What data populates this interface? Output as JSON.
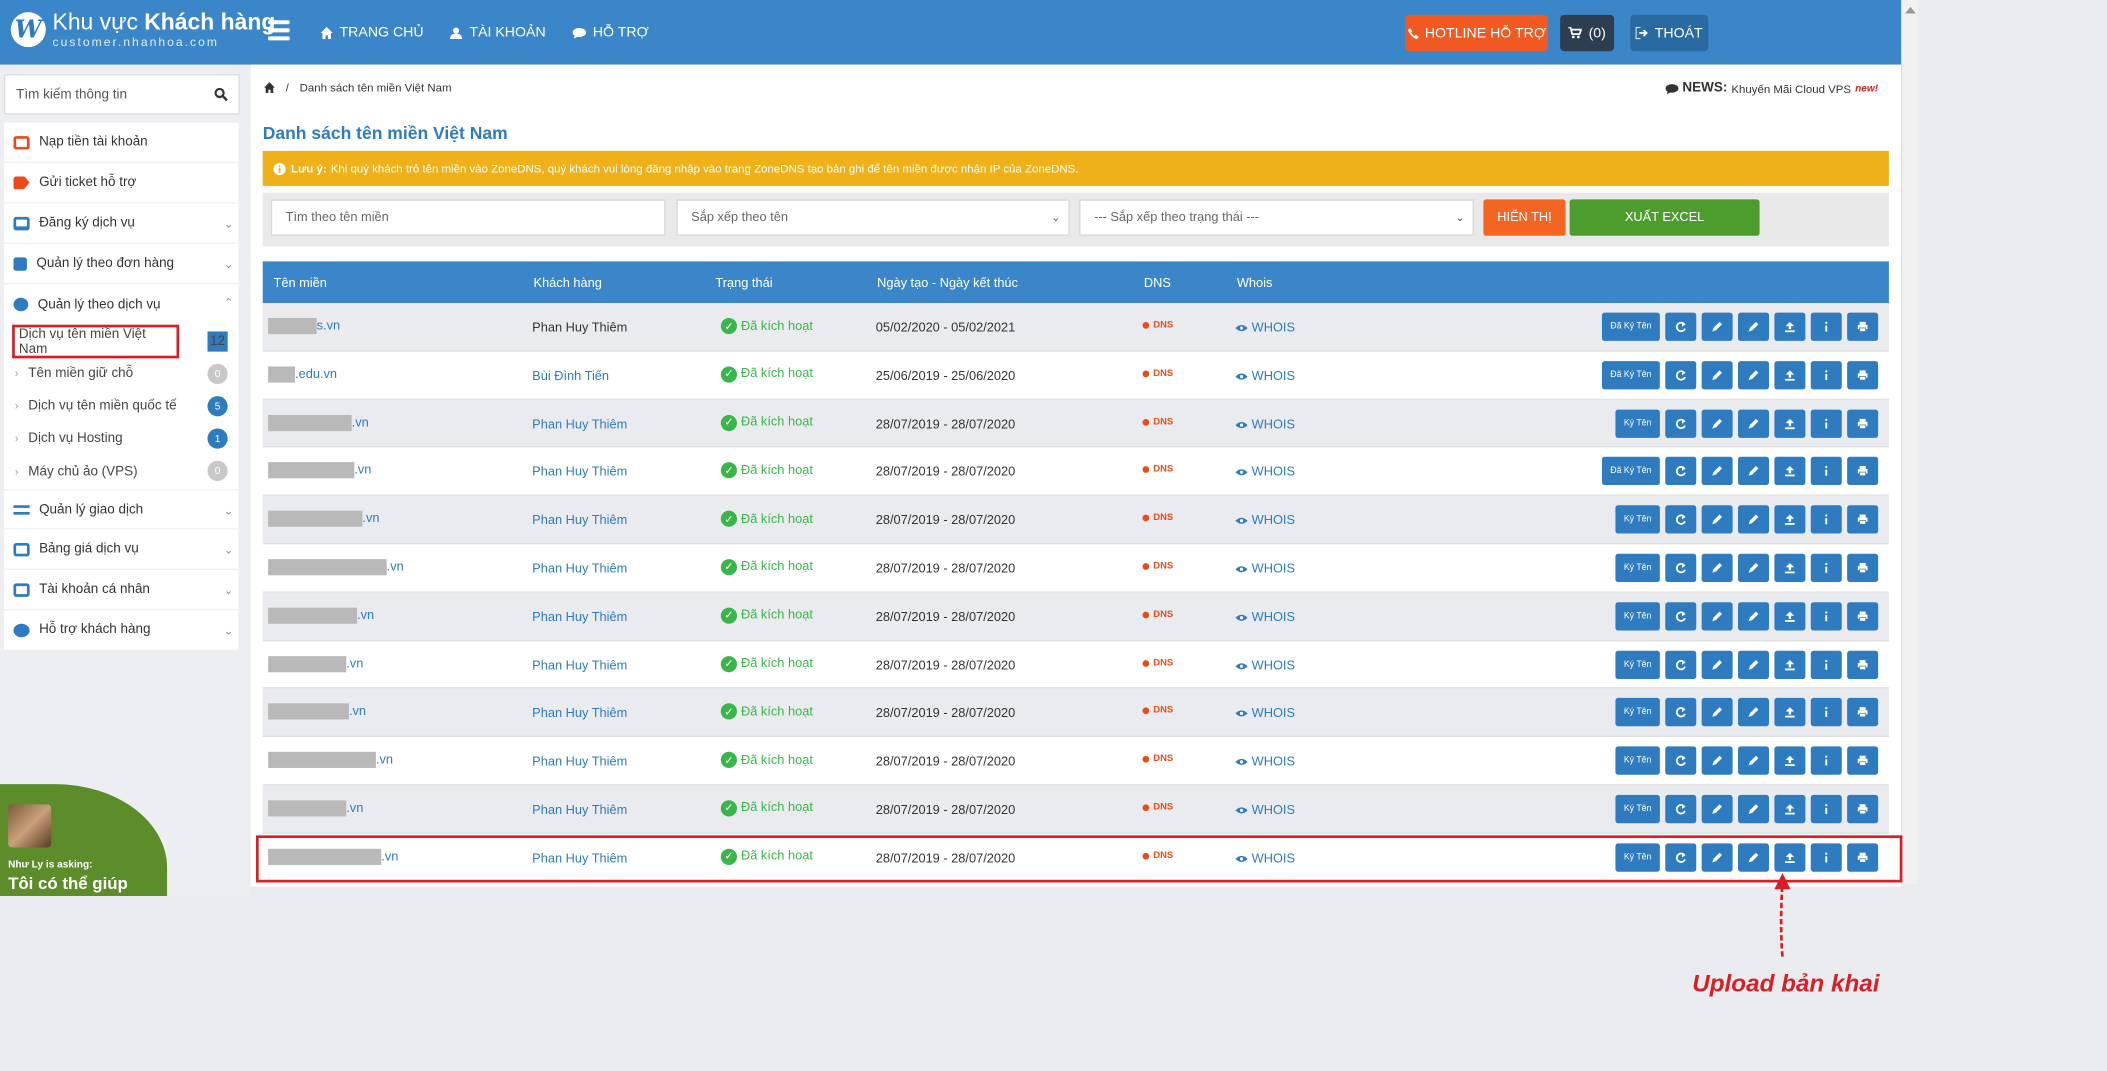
{
  "app": {
    "logo_title_regular": "Khu vực ",
    "logo_title_bold": "Khách hàng",
    "logo_subtitle": "customer.nhanhoa.com",
    "logo_letter": "W"
  },
  "nav": [
    {
      "label": "TRANG CHỦ",
      "icon": "home-icon"
    },
    {
      "label": "TÀI KHOẢN",
      "icon": "user-icon"
    },
    {
      "label": "HỖ TRỢ",
      "icon": "chat-icon"
    }
  ],
  "header_buttons": {
    "hotline": "HOTLINE HỖ TRỢ",
    "cart": "(0)",
    "logout": "THOÁT"
  },
  "sidebar": {
    "search_placeholder": "Tìm kiếm thông tin",
    "items": [
      {
        "label": "Nạp tiền tài khoản",
        "icon": "wallet-icon",
        "color": "#e94b1a",
        "chevron": false
      },
      {
        "label": "Gửi ticket hỗ trợ",
        "icon": "tag-icon",
        "color": "#e94b1a",
        "chevron": false
      },
      {
        "label": "Đăng ký dịch vụ",
        "icon": "laptop-icon",
        "color": "#2e7bbf",
        "chevron": true
      },
      {
        "label": "Quản lý theo đơn hàng",
        "icon": "document-icon",
        "color": "#2e7bbf",
        "chevron": true
      },
      {
        "label": "Quản lý theo dịch vụ",
        "icon": "cogs-icon",
        "color": "#2e7bbf",
        "chevron": true
      }
    ],
    "subitems": [
      {
        "label": "Dịch vụ tên miền Việt Nam",
        "count": "12",
        "count_color": "#2e7bbf"
      },
      {
        "label": "Tên miền giữ chỗ",
        "count": "0",
        "count_color": "#c8c8c8"
      },
      {
        "label": "Dịch vụ tên miền quốc tế",
        "count": "5",
        "count_color": "#2e7bbf"
      },
      {
        "label": "Dịch vụ Hosting",
        "count": "1",
        "count_color": "#2e7bbf"
      },
      {
        "label": "Máy chủ ảo (VPS)",
        "count": "0",
        "count_color": "#c8c8c8"
      }
    ],
    "items_after": [
      {
        "label": "Quản lý giao dịch",
        "icon": "exchange-icon",
        "color": "#2e7bbf"
      },
      {
        "label": "Bảng giá dịch vụ",
        "icon": "money-icon",
        "color": "#2e7bbf"
      },
      {
        "label": "Tài khoản cá nhân",
        "icon": "idcard-icon",
        "color": "#2e7bbf"
      },
      {
        "label": "Hỗ trợ khách hàng",
        "icon": "comments-icon",
        "color": "#2e7bbf"
      }
    ]
  },
  "chat_widget": {
    "asking": "Như Ly is asking:",
    "message": "Tôi có thể giúp"
  },
  "breadcrumb": {
    "current": "Danh sách tên miền Việt Nam"
  },
  "news": {
    "label": "NEWS:",
    "text": "Khuyến Mãi Cloud VPS",
    "badge": "new!"
  },
  "page_title": "Danh sách tên miền Việt Nam",
  "notice": {
    "label": "Lưu ý:",
    "text": "Khi quý khách trỏ tên miền vào ZoneDNS, quý khách vui lòng đăng nhập vào trang ZoneDNS tạo bản ghi để tên miền được nhận IP của ZoneDNS."
  },
  "filters": {
    "domain_placeholder": "Tìm theo tên miền",
    "sort_selected": "Sắp xếp theo tên",
    "status_selected": "--- Sắp xếp theo trạng thái ---",
    "show_button": "HIỂN THỊ",
    "excel_button": "XUẤT EXCEL"
  },
  "table": {
    "columns": [
      "Tên miền",
      "Khách hàng",
      "Trạng thái",
      "Ngày tạo - Ngày kết thúc",
      "DNS",
      "Whois"
    ],
    "status_text": "Đã kích hoạt",
    "dns_text": "DNS",
    "whois_text": "WHOIS",
    "rows": [
      {
        "domain_suffix": "s.vn",
        "customer": "Phan Huy Thiêm",
        "customer_link": false,
        "dates": "05/02/2020 - 05/02/2021",
        "sign": "Đã Ký Tên"
      },
      {
        "domain_suffix": ".edu.vn",
        "customer": "Bùi Đình Tiến",
        "customer_link": true,
        "dates": "25/06/2019 - 25/06/2020",
        "sign": "Đã Ký Tên"
      },
      {
        "domain_suffix": ".vn",
        "customer": "Phan Huy Thiêm",
        "customer_link": true,
        "dates": "28/07/2019 - 28/07/2020",
        "sign": "Ký Tên"
      },
      {
        "domain_suffix": ".vn",
        "customer": "Phan Huy Thiêm",
        "customer_link": true,
        "dates": "28/07/2019 - 28/07/2020",
        "sign": "Đã Ký Tên"
      },
      {
        "domain_suffix": ".vn",
        "customer": "Phan Huy Thiêm",
        "customer_link": true,
        "dates": "28/07/2019 - 28/07/2020",
        "sign": "Ký Tên"
      },
      {
        "domain_suffix": ".vn",
        "customer": "Phan Huy Thiêm",
        "customer_link": true,
        "dates": "28/07/2019 - 28/07/2020",
        "sign": "Ký Tên"
      },
      {
        "domain_suffix": ".vn",
        "customer": "Phan Huy Thiêm",
        "customer_link": true,
        "dates": "28/07/2019 - 28/07/2020",
        "sign": "Ký Tên"
      },
      {
        "domain_suffix": ".vn",
        "customer": "Phan Huy Thiêm",
        "customer_link": true,
        "dates": "28/07/2019 - 28/07/2020",
        "sign": "Ký Tên"
      },
      {
        "domain_suffix": ".vn",
        "customer": "Phan Huy Thiêm",
        "customer_link": true,
        "dates": "28/07/2019 - 28/07/2020",
        "sign": "Ký Tên"
      },
      {
        "domain_suffix": ".vn",
        "customer": "Phan Huy Thiêm",
        "customer_link": true,
        "dates": "28/07/2019 - 28/07/2020",
        "sign": "Ký Tên"
      },
      {
        "domain_suffix": ".vn",
        "customer": "Phan Huy Thiêm",
        "customer_link": true,
        "dates": "28/07/2019 - 28/07/2020",
        "sign": "Ký Tên"
      },
      {
        "domain_suffix": ".vn",
        "customer": "Phan Huy Thiêm",
        "customer_link": true,
        "dates": "28/07/2019 - 28/07/2020",
        "sign": "Ký Tên"
      }
    ],
    "action_icons": [
      "refresh-icon",
      "pencil-icon",
      "pencil-icon",
      "upload-icon",
      "info-icon",
      "print-icon"
    ]
  },
  "annotation": {
    "text": "Upload bản khai"
  }
}
